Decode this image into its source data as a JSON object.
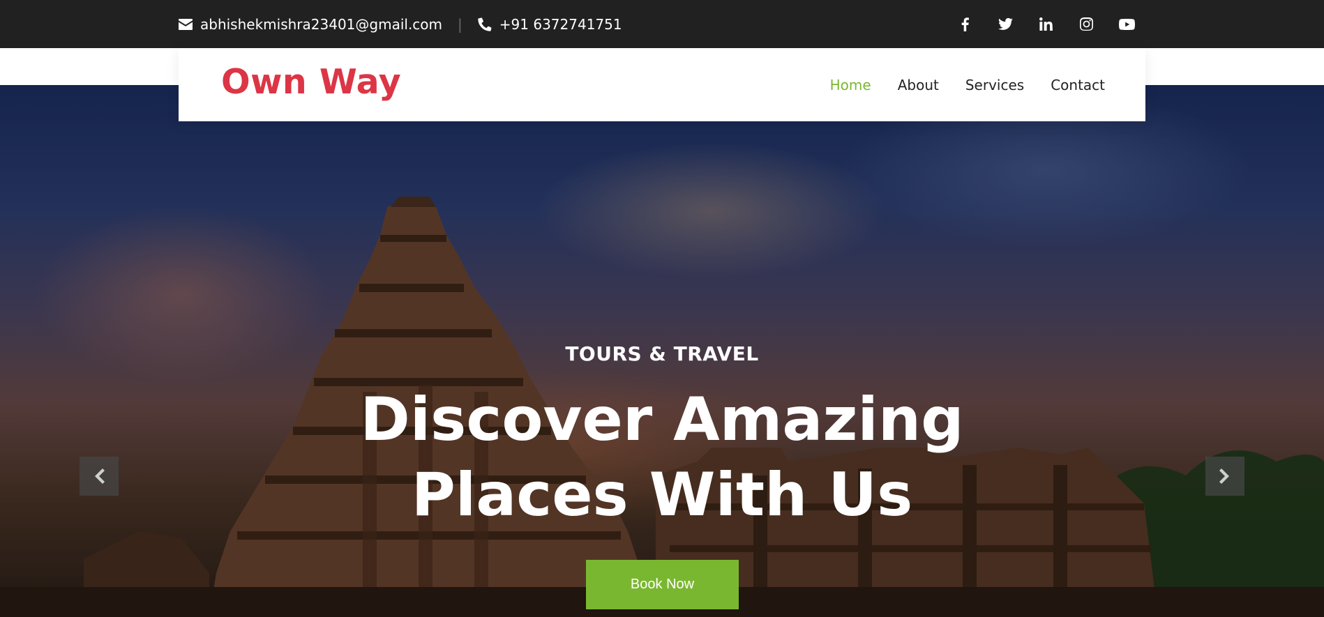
{
  "topbar": {
    "email": "abhishekmishra23401@gmail.com",
    "separator": "|",
    "phone": "+91 6372741751",
    "socials": [
      "facebook-icon",
      "twitter-icon",
      "linkedin-icon",
      "instagram-icon",
      "youtube-icon"
    ]
  },
  "navbar": {
    "logo": "Own Way",
    "menu": [
      "Home",
      "About",
      "Services",
      "Contact"
    ],
    "active": "Home"
  },
  "hero": {
    "subtitle": "TOURS & TRAVEL",
    "headline_line1": "Discover Amazing",
    "headline_line2": "Places With Us",
    "cta": "Book Now"
  },
  "colors": {
    "brand_red": "#dc3545",
    "accent_green": "#7ab730",
    "topbar_bg": "#212121"
  }
}
